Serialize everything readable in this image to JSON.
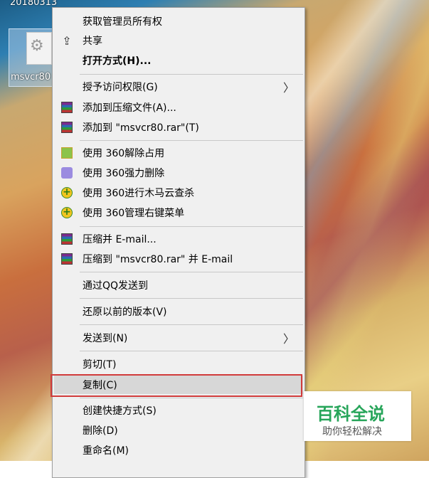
{
  "desktop": {
    "date_text": "20180313",
    "icon_label": "msvcr80"
  },
  "menu": {
    "items": [
      {
        "label": "获取管理员所有权",
        "icon": "none"
      },
      {
        "label": "共享",
        "icon": "share-icon"
      },
      {
        "label": "打开方式(H)...",
        "icon": "none",
        "bold": true
      },
      {
        "label": "授予访问权限(G)",
        "icon": "none",
        "submenu": true
      },
      {
        "label": "添加到压缩文件(A)...",
        "icon": "winrar-icon"
      },
      {
        "label": "添加到 \"msvcr80.rar\"(T)",
        "icon": "winrar-icon"
      },
      {
        "label": "使用 360解除占用",
        "icon": "360-unlock-icon"
      },
      {
        "label": "使用 360强力删除",
        "icon": "360-delete-icon"
      },
      {
        "label": "使用 360进行木马云查杀",
        "icon": "360-scan-icon"
      },
      {
        "label": "使用 360管理右键菜单",
        "icon": "360-manage-icon"
      },
      {
        "label": "压缩并 E-mail...",
        "icon": "winrar-icon"
      },
      {
        "label": "压缩到 \"msvcr80.rar\" 并 E-mail",
        "icon": "winrar-icon"
      },
      {
        "label": "通过QQ发送到",
        "icon": "none"
      },
      {
        "label": "还原以前的版本(V)",
        "icon": "none"
      },
      {
        "label": "发送到(N)",
        "icon": "none",
        "submenu": true
      },
      {
        "label": "剪切(T)",
        "icon": "none"
      },
      {
        "label": "复制(C)",
        "icon": "none",
        "highlighted": true
      },
      {
        "label": "创建快捷方式(S)",
        "icon": "none"
      },
      {
        "label": "删除(D)",
        "icon": "none"
      },
      {
        "label": "重命名(M)",
        "icon": "none"
      }
    ],
    "highlight_color": "#d13b3b"
  },
  "watermark": {
    "title": "百科全说",
    "subtitle": "助你轻松解决",
    "title_color": "#27a55a"
  }
}
